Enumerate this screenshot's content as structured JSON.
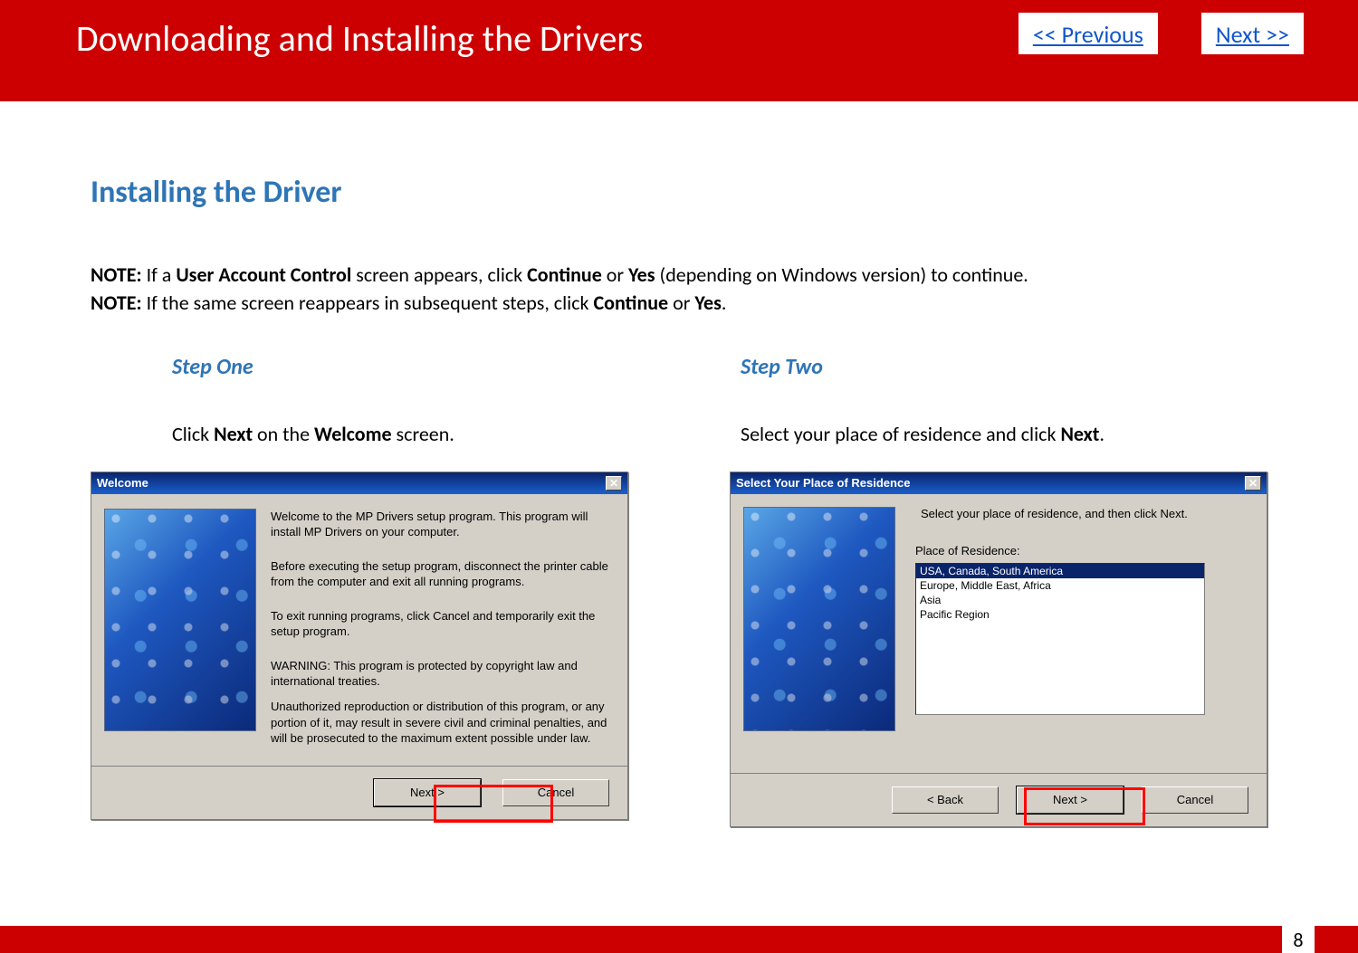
{
  "banner": {
    "title": "Downloading and Installing  the Drivers",
    "prev": " << Previous",
    "next": "Next >>"
  },
  "section_title": "Installing the Driver",
  "notes": {
    "n1_label": "NOTE:",
    "n1_a": " If a ",
    "n1_b": "User Account Control",
    "n1_c": " screen appears, click ",
    "n1_d": "Continue",
    "n1_e": " or ",
    "n1_f": "Yes",
    "n1_g": " (depending on Windows version) to continue.",
    "n2_label": "NOTE:",
    "n2_a": " If the same screen reappears in subsequent steps, click ",
    "n2_b": "Continue",
    "n2_c": " or ",
    "n2_d": "Yes",
    "n2_e": "."
  },
  "step1": {
    "title": "Step One",
    "instr_a": "Click ",
    "instr_b": "Next",
    "instr_c": " on the ",
    "instr_d": "Welcome",
    "instr_e": " screen.",
    "dlg_title": "Welcome",
    "p1": "Welcome to the MP Drivers setup program. This program will install MP Drivers on your computer.",
    "p2": "Before executing the setup program, disconnect the printer cable from the computer and exit all running programs.",
    "p3": "To exit running programs, click Cancel and temporarily exit the setup program.",
    "p4": "WARNING: This program is protected by copyright law and international treaties.",
    "p5": "Unauthorized reproduction or distribution of this program, or any portion of it, may result in severe civil and criminal penalties, and will be prosecuted to the maximum extent possible under law.",
    "btn_next": "Next >",
    "btn_cancel": "Cancel"
  },
  "step2": {
    "title": "Step Two",
    "instr_a": "Select your place of residence and click ",
    "instr_b": "Next",
    "instr_c": ".",
    "dlg_title": "Select Your Place of Residence",
    "top_text": "Select your place of residence, and then click Next.",
    "list_label": "Place of Residence:",
    "options": [
      "USA, Canada, South America",
      "Europe, Middle East, Africa",
      "Asia",
      "Pacific Region"
    ],
    "btn_back": "< Back",
    "btn_next": "Next >",
    "btn_cancel": "Cancel"
  },
  "page_number": "8",
  "close_x": "✕"
}
